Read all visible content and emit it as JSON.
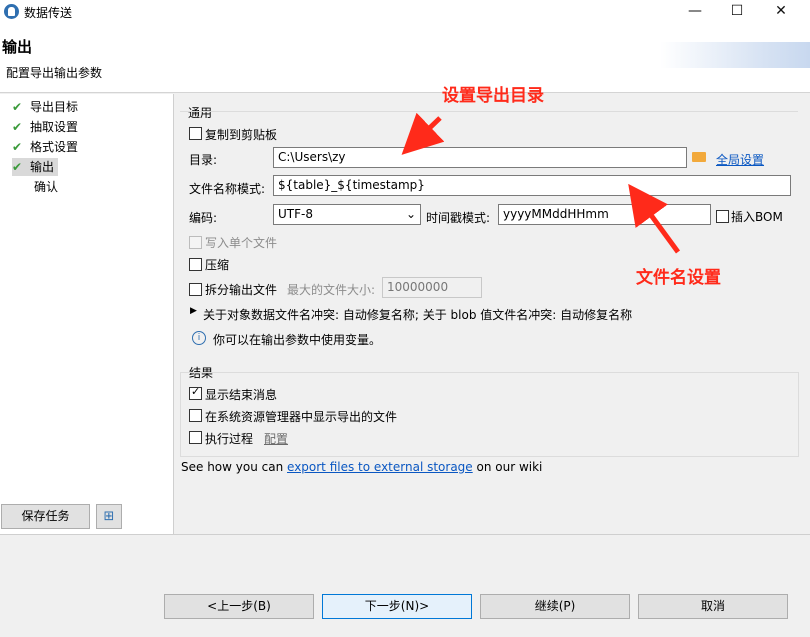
{
  "window": {
    "title": "数据传送",
    "minimize": "—",
    "maximize": "☐",
    "close": "✕"
  },
  "header": {
    "title": "输出",
    "subtitle": "配置导出输出参数"
  },
  "nav": {
    "items": [
      {
        "label": "导出目标",
        "done": true
      },
      {
        "label": "抽取设置",
        "done": true
      },
      {
        "label": "格式设置",
        "done": true
      },
      {
        "label": "输出",
        "done": true,
        "selected": true
      },
      {
        "label": "确认",
        "done": false
      }
    ],
    "save_task": "保存任务"
  },
  "general": {
    "title": "通用",
    "copy_clipboard": "复制到剪贴板",
    "dir_label": "目录:",
    "dir_value": "C:\\Users\\zy",
    "global_settings": "全局设置",
    "filename_label": "文件名称模式:",
    "filename_value": "${table}_${timestamp}",
    "encoding_label": "编码:",
    "encoding_value": "UTF-8",
    "timestamp_label": "时间戳模式:",
    "timestamp_value": "yyyyMMddHHmm",
    "insert_bom": "插入BOM",
    "write_single": "写入单个文件",
    "compress": "压缩",
    "split_output": "拆分输出文件",
    "max_size_label": "最大的文件大小:",
    "max_size_value": "10000000",
    "conflict_text": "关于对象数据文件名冲突: 自动修复名称; 关于 blob 值文件名冲突: 自动修复名称",
    "info_text": "你可以在输出参数中使用变量。"
  },
  "result": {
    "title": "结果",
    "show_finish": "显示结束消息",
    "show_in_explorer": "在系统资源管理器中显示导出的文件",
    "exec_process": "执行过程",
    "configure": "配置"
  },
  "wiki": {
    "prefix": "See how you can ",
    "link": "export files to external storage",
    "suffix": " on our wiki"
  },
  "footer": {
    "prev": "<上一步(B)",
    "next": "下一步(N)>",
    "continue": "继续(P)",
    "cancel": "取消"
  },
  "annotations": {
    "dir": "设置导出目录",
    "filename": "文件名设置",
    "color": "#ff2a1a"
  },
  "checkbox_state": {
    "copy_clipboard": false,
    "insert_bom": false,
    "write_single": false,
    "compress": false,
    "split_output": false,
    "show_finish": true,
    "show_in_explorer": false,
    "exec_process": false
  }
}
